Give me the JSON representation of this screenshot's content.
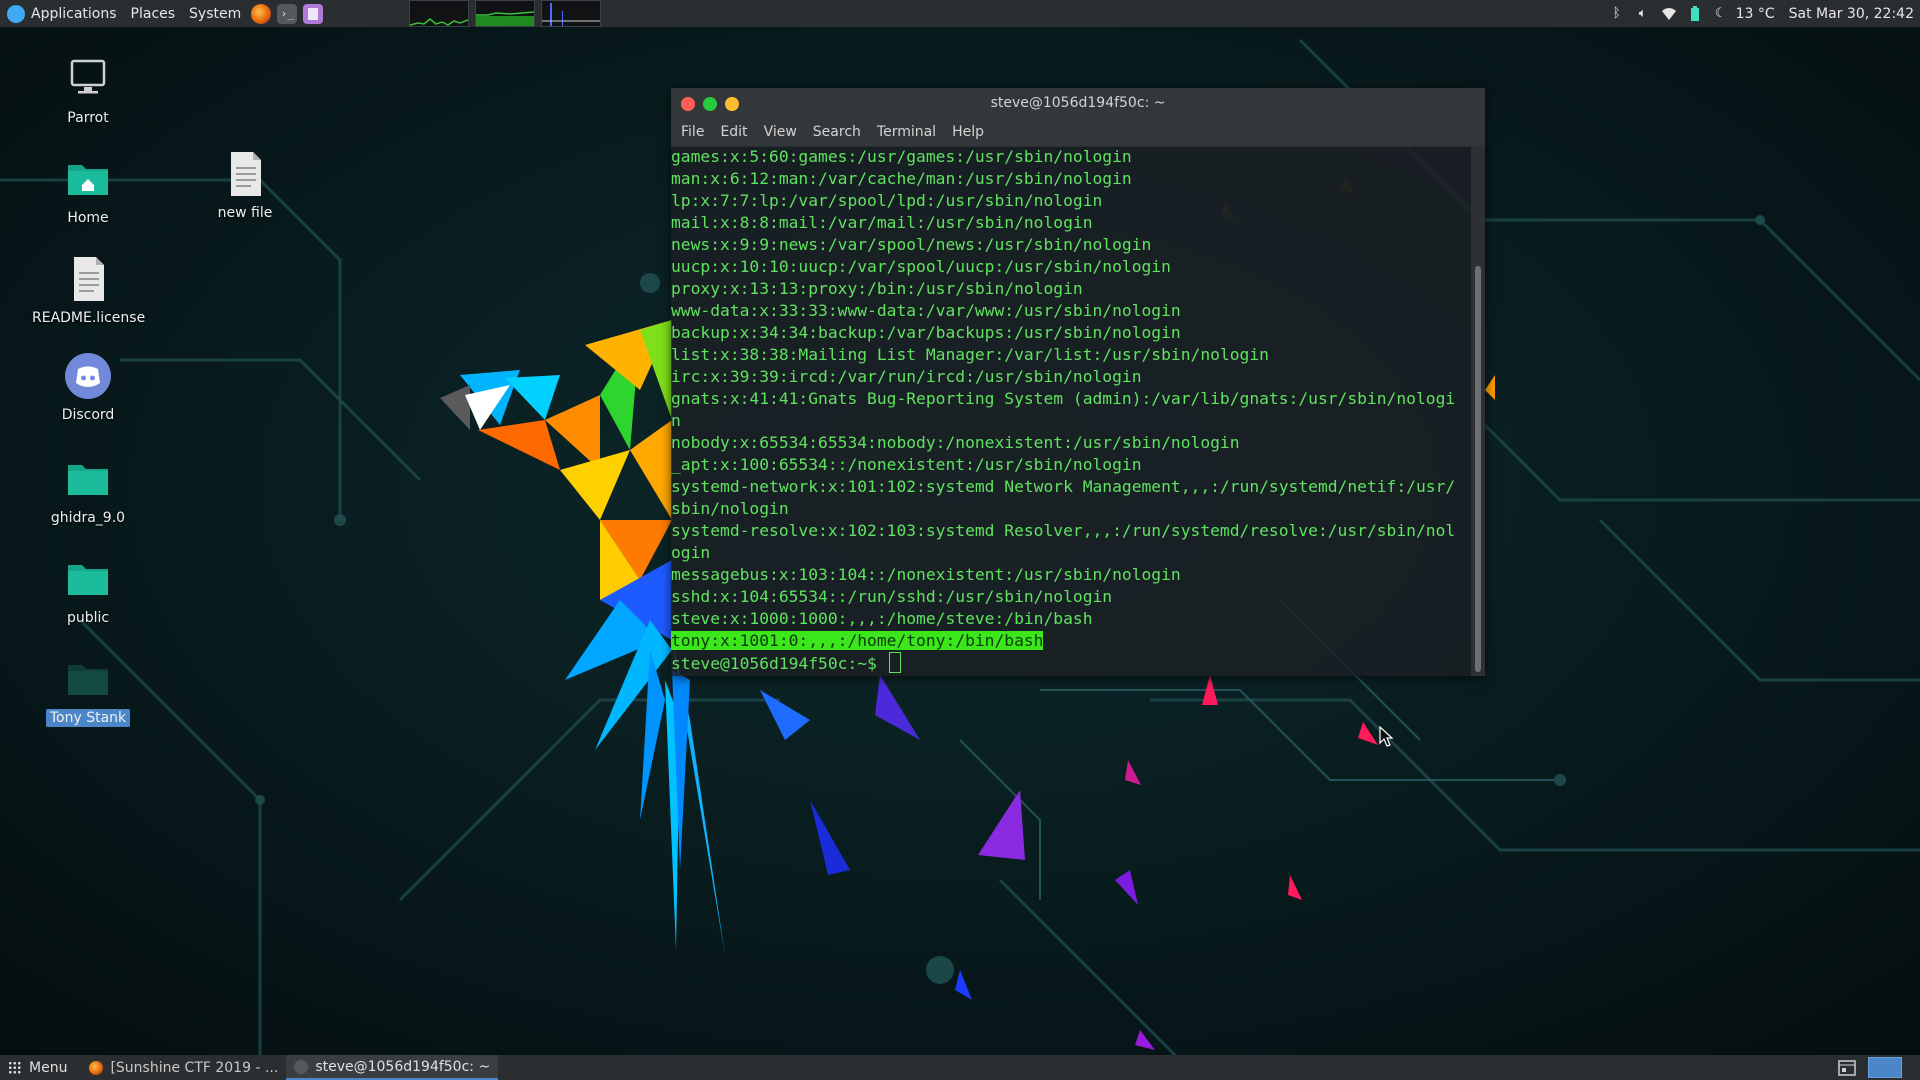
{
  "top_panel": {
    "menus": [
      "Applications",
      "Places",
      "System"
    ],
    "launchers": [
      "firefox-icon",
      "terminal-icon",
      "text-editor-icon"
    ],
    "weather": "13 °C",
    "clock": "Sat Mar 30, 22:42",
    "tray_icons": [
      "bluetooth-icon",
      "volume-icon",
      "wifi-icon",
      "battery-icon",
      "weather-icon"
    ]
  },
  "desktop": {
    "icons": [
      {
        "label": "Parrot",
        "icon": "computer-icon"
      },
      {
        "label": "Home",
        "icon": "home-folder-icon"
      },
      {
        "label": "README.license",
        "icon": "text-file-icon"
      },
      {
        "label": "Discord",
        "icon": "discord-icon"
      },
      {
        "label": "ghidra_9.0",
        "icon": "folder-icon"
      },
      {
        "label": "public",
        "icon": "folder-icon"
      },
      {
        "label": "Tony Stank",
        "icon": "folder-icon"
      },
      {
        "label": "new file",
        "icon": "text-file-icon"
      }
    ]
  },
  "terminal": {
    "title": "steve@1056d194f50c: ~",
    "menu": [
      "File",
      "Edit",
      "View",
      "Search",
      "Terminal",
      "Help"
    ],
    "lines": [
      "games:x:5:60:games:/usr/games:/usr/sbin/nologin",
      "man:x:6:12:man:/var/cache/man:/usr/sbin/nologin",
      "lp:x:7:7:lp:/var/spool/lpd:/usr/sbin/nologin",
      "mail:x:8:8:mail:/var/mail:/usr/sbin/nologin",
      "news:x:9:9:news:/var/spool/news:/usr/sbin/nologin",
      "uucp:x:10:10:uucp:/var/spool/uucp:/usr/sbin/nologin",
      "proxy:x:13:13:proxy:/bin:/usr/sbin/nologin",
      "www-data:x:33:33:www-data:/var/www:/usr/sbin/nologin",
      "backup:x:34:34:backup:/var/backups:/usr/sbin/nologin",
      "list:x:38:38:Mailing List Manager:/var/list:/usr/sbin/nologin",
      "irc:x:39:39:ircd:/var/run/ircd:/usr/sbin/nologin",
      "gnats:x:41:41:Gnats Bug-Reporting System (admin):/var/lib/gnats:/usr/sbin/nologi",
      "n",
      "nobody:x:65534:65534:nobody:/nonexistent:/usr/sbin/nologin",
      "_apt:x:100:65534::/nonexistent:/usr/sbin/nologin",
      "systemd-network:x:101:102:systemd Network Management,,,:/run/systemd/netif:/usr/",
      "sbin/nologin",
      "systemd-resolve:x:102:103:systemd Resolver,,,:/run/systemd/resolve:/usr/sbin/nol",
      "ogin",
      "messagebus:x:103:104::/nonexistent:/usr/sbin/nologin",
      "sshd:x:104:65534::/run/sshd:/usr/sbin/nologin",
      "steve:x:1000:1000:,,,:/home/steve:/bin/bash"
    ],
    "highlighted_line": "tony:x:1001:0:,,,:/home/tony:/bin/bash",
    "prompt": "steve@1056d194f50c:~$ "
  },
  "taskbar": {
    "menu_label": "Menu",
    "tasks": [
      {
        "label": "[Sunshine CTF 2019 - ...",
        "icon": "firefox-icon",
        "active": false
      },
      {
        "label": "steve@1056d194f50c: ~",
        "icon": "terminal-icon",
        "active": true
      }
    ],
    "workspaces": 2
  },
  "colors": {
    "terminal_text": "#5fe35f",
    "highlight": "#3be61b",
    "panel": "#2b2e31",
    "selection": "#4a86c8",
    "close": "#ff5f57",
    "minimize": "#28c940",
    "maximize": "#febc2e"
  }
}
